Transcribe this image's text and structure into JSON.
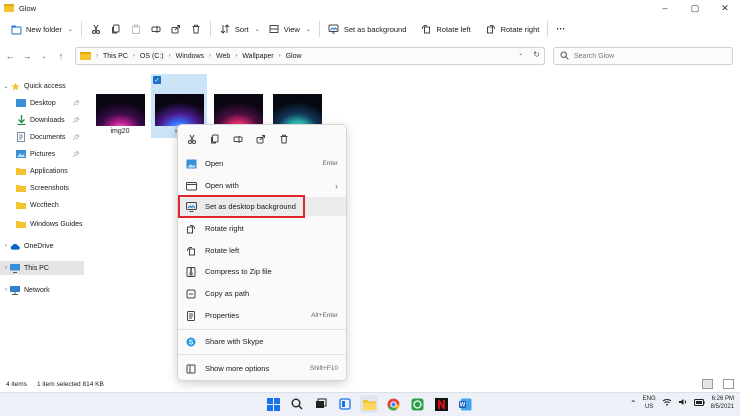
{
  "window": {
    "title": "Glow",
    "controls": [
      "–",
      "▢",
      "✕"
    ]
  },
  "toolbar": {
    "new_folder": "New folder",
    "sort": "Sort",
    "view": "View",
    "set_as_background": "Set as background",
    "rotate_left": "Rotate left",
    "rotate_right": "Rotate right",
    "more": "···"
  },
  "address": {
    "breadcrumbs": [
      "This PC",
      "OS (C:)",
      "Windows",
      "Web",
      "Wallpaper",
      "Glow"
    ],
    "search_placeholder": "Search Glow"
  },
  "sidebar": {
    "items": [
      {
        "label": "Quick access",
        "icon": "star-icon"
      },
      {
        "label": "Desktop",
        "icon": "desktop-icon"
      },
      {
        "label": "Downloads",
        "icon": "download-icon"
      },
      {
        "label": "Documents",
        "icon": "document-icon"
      },
      {
        "label": "Pictures",
        "icon": "pictures-icon"
      },
      {
        "label": "Applications",
        "icon": "folder-icon"
      },
      {
        "label": "Screenshots",
        "icon": "folder-icon"
      },
      {
        "label": "Wccftech",
        "icon": "folder-icon"
      },
      {
        "label": "Windows Guides",
        "icon": "folder-icon"
      },
      {
        "label": "OneDrive",
        "icon": "cloud-icon"
      },
      {
        "label": "This PC",
        "icon": "computer-icon"
      },
      {
        "label": "Network",
        "icon": "network-icon"
      }
    ]
  },
  "files": [
    {
      "label": "img20",
      "selected": false
    },
    {
      "label": "im",
      "selected": true
    },
    {
      "label": "",
      "selected": false
    },
    {
      "label": "",
      "selected": false
    }
  ],
  "context_menu": {
    "items": [
      {
        "label": "Open",
        "shortcut": "Enter",
        "icon": "open-icon"
      },
      {
        "label": "Open with",
        "shortcut": "›",
        "icon": "open-with-icon"
      },
      {
        "label": "Set as desktop background",
        "shortcut": "",
        "icon": "background-icon"
      },
      {
        "label": "Rotate right",
        "shortcut": "",
        "icon": "rotate-right-icon"
      },
      {
        "label": "Rotate left",
        "shortcut": "",
        "icon": "rotate-left-icon"
      },
      {
        "label": "Compress to Zip file",
        "shortcut": "",
        "icon": "zip-icon"
      },
      {
        "label": "Copy as path",
        "shortcut": "",
        "icon": "copy-path-icon"
      },
      {
        "label": "Properties",
        "shortcut": "Alt+Enter",
        "icon": "properties-icon"
      },
      {
        "label": "Share with Skype",
        "shortcut": "",
        "icon": "skype-icon"
      },
      {
        "label": "Show more options",
        "shortcut": "Shift+F10",
        "icon": "more-options-icon"
      }
    ]
  },
  "status": {
    "count": "4 items",
    "selection": "1 item selected  814 KB"
  },
  "tray": {
    "lang_top": "ENG",
    "lang_bottom": "US",
    "time": "6:26 PM",
    "date": "8/5/2021"
  },
  "colors": {
    "accent": "#1a73c8",
    "highlight_box": "#e0262c",
    "selection": "#cce4f7"
  }
}
